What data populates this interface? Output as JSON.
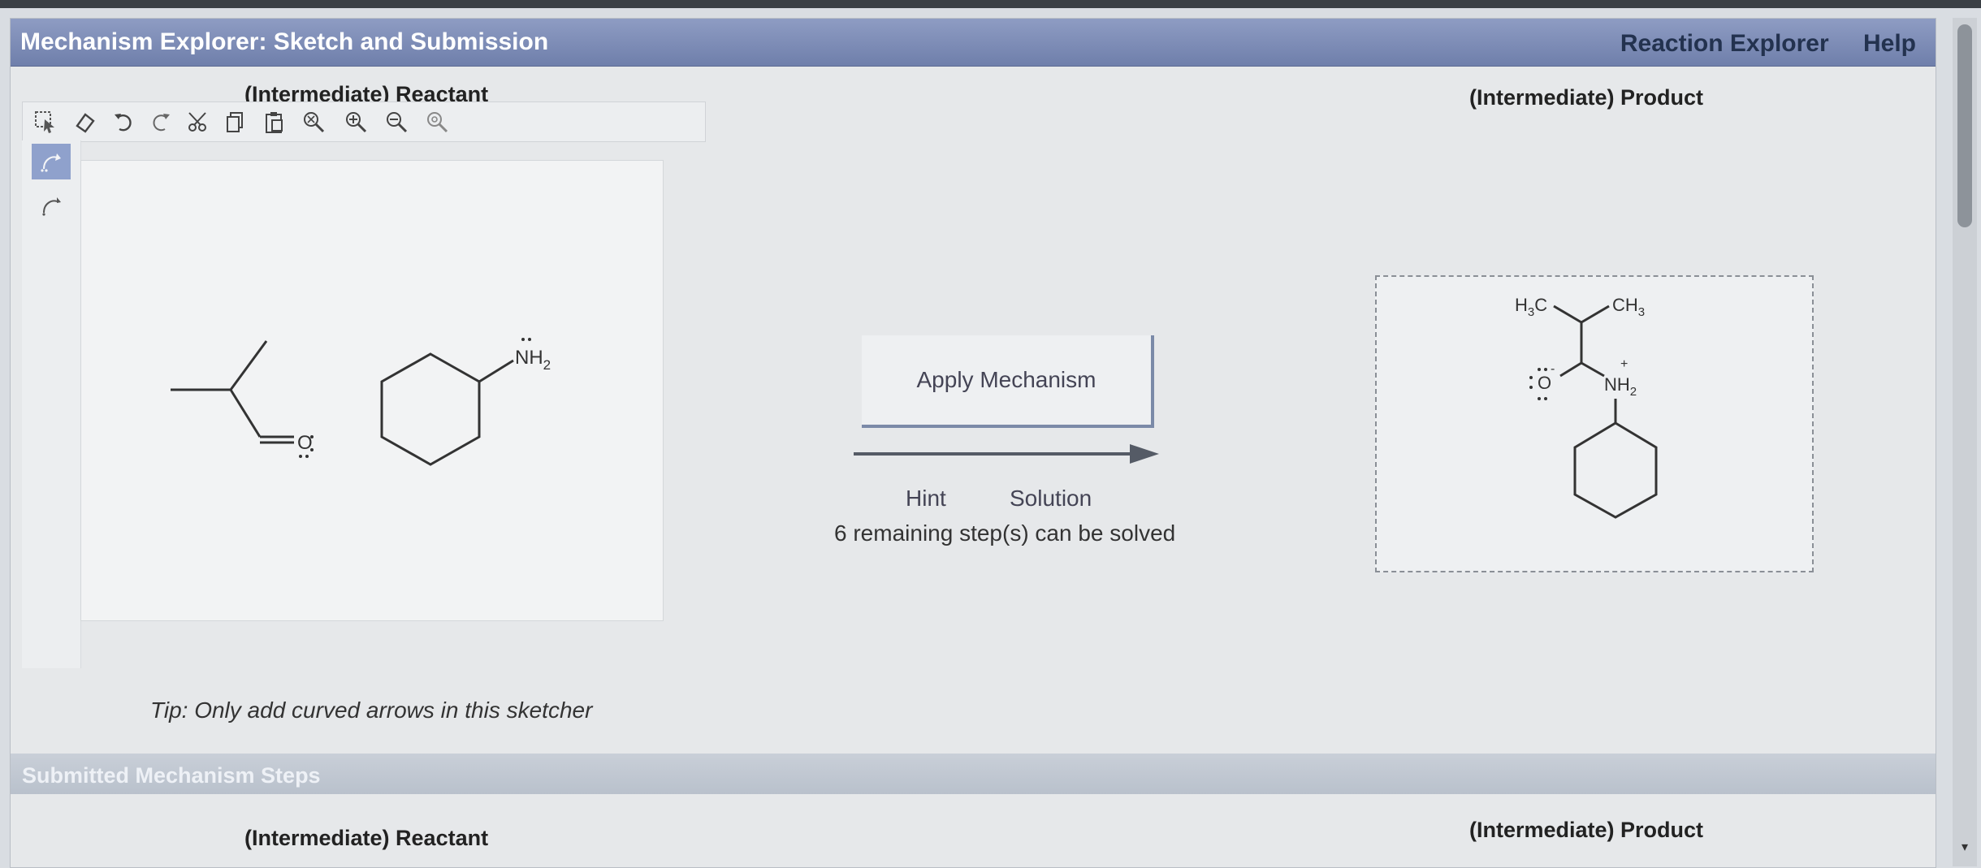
{
  "window": {
    "title": "Mechanism Explorer: Sketch and Submission",
    "nav": [
      "Reaction Explorer",
      "Help"
    ]
  },
  "reactant_panel": {
    "label": "(Intermediate) Reactant",
    "toolbar_icons": [
      "select-icon",
      "eraser-icon",
      "undo-icon",
      "redo-icon",
      "cut-icon",
      "copy-icon",
      "paste-icon",
      "zoom-fit-icon",
      "zoom-in-icon",
      "zoom-out-icon",
      "zoom-reset-icon"
    ],
    "side_tools": [
      "electron-pair-arrow-icon",
      "single-electron-arrow-icon"
    ],
    "molecules": {
      "carbonyl_atom": "O",
      "amine_label": "NH",
      "amine_subscript": "2"
    },
    "tip": "Tip: Only add curved arrows in this sketcher"
  },
  "center": {
    "apply_label": "Apply Mechanism",
    "hint_label": "Hint",
    "solution_label": "Solution",
    "remaining_text": "6 remaining step(s) can be solved"
  },
  "product_panel": {
    "label": "(Intermediate) Product",
    "molecule": {
      "left_methyl_main": "H",
      "left_methyl_sub": "3",
      "left_methyl_tail": "C",
      "right_methyl_main": "CH",
      "right_methyl_sub": "3",
      "oxygen": "O",
      "oxygen_charge": "-",
      "amine_main": "NH",
      "amine_sub": "2",
      "amine_charge": "+"
    }
  },
  "submitted": {
    "header": "Submitted Mechanism Steps",
    "reactant_label": "(Intermediate) Reactant",
    "product_label": "(Intermediate) Product"
  },
  "colors": {
    "titlebar": "#7d8cb6",
    "accent": "#6f7fab"
  }
}
